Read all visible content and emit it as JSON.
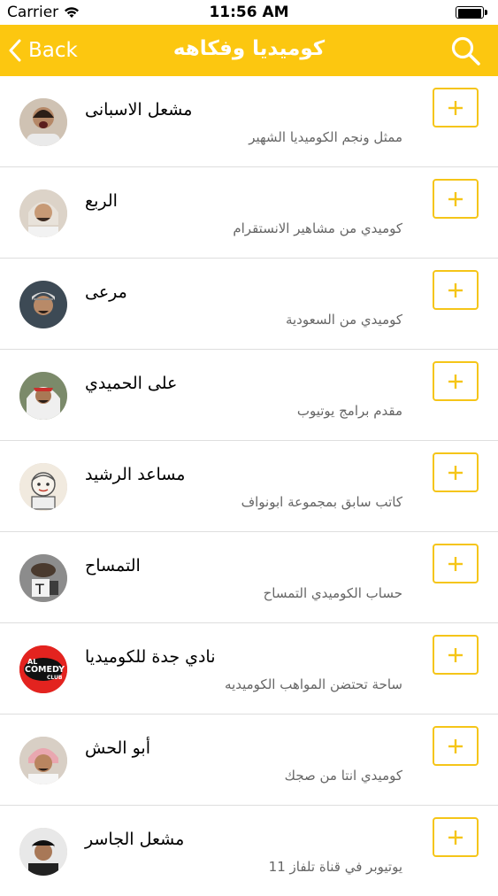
{
  "status_bar": {
    "carrier": "Carrier",
    "time": "11:56 AM"
  },
  "nav": {
    "back_label": "Back",
    "title": "كوميديا وفكاهه"
  },
  "colors": {
    "accent": "#fcc710",
    "button_border": "#f5c518"
  },
  "contacts": [
    {
      "name": "مشعل الاسبانى",
      "description": "ممثل ونجم الكوميديا الشهير",
      "avatar": "person-photo"
    },
    {
      "name": "الربع",
      "description": "كوميدي من مشاهير الانستقرام",
      "avatar": "person-photo"
    },
    {
      "name": "مرعى",
      "description": "كوميدي من السعودية",
      "avatar": "person-photo"
    },
    {
      "name": "على الحميدي",
      "description": "مقدم برامج يوتيوب",
      "avatar": "person-photo"
    },
    {
      "name": "مساعد الرشيد",
      "description": "كاتب سابق بمجموعة ابونواف",
      "avatar": "cartoon-character"
    },
    {
      "name": "التمساح",
      "description": "حساب الكوميدي التمساح",
      "avatar": "hand-figure"
    },
    {
      "name": "نادي جدة للكوميديا",
      "description": "ساحة تحتضن المواهب الكوميديه",
      "avatar": "comedy-club-logo"
    },
    {
      "name": "أبو الحش",
      "description": "كوميدي انتا من صجك",
      "avatar": "person-photo"
    },
    {
      "name": "مشعل الجاسر",
      "description": "يوتيوبر في قناة تلفاز 11",
      "avatar": "person-photo"
    }
  ],
  "logo_text": {
    "line1": "AL",
    "line2": "COMEDY",
    "line3": "CLUB"
  }
}
